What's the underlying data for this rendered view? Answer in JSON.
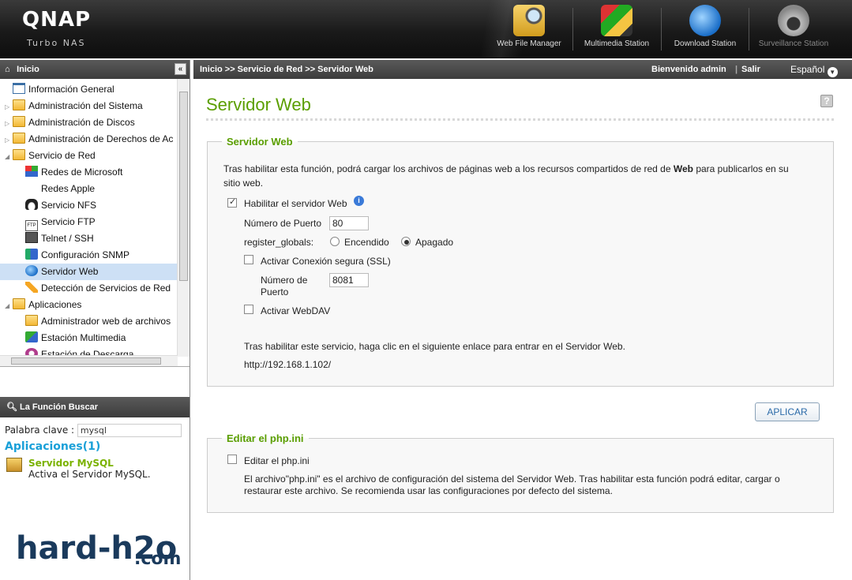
{
  "header": {
    "logo": "QNAP",
    "logo_sub": "Turbo NAS",
    "apps": [
      {
        "label": "Web File Manager",
        "icon": "folder-magnifier-icon"
      },
      {
        "label": "Multimedia Station",
        "icon": "film-clapper-icon"
      },
      {
        "label": "Download Station",
        "icon": "globe-download-icon"
      },
      {
        "label": "Surveillance Station",
        "icon": "security-camera-icon"
      }
    ]
  },
  "sidebar": {
    "title": "Inicio",
    "tree": [
      {
        "label": "Información General",
        "level": 1,
        "icon": "info-list-icon"
      },
      {
        "label": "Administración del Sistema",
        "level": 0,
        "icon": "folder-icon"
      },
      {
        "label": "Administración de Discos",
        "level": 0,
        "icon": "folder-icon"
      },
      {
        "label": "Administración de Derechos de Ac",
        "level": 0,
        "icon": "folder-icon"
      },
      {
        "label": "Servicio de Red",
        "level": 0,
        "icon": "folder-icon"
      },
      {
        "label": "Redes de Microsoft",
        "level": 1,
        "icon": "windows-logo-icon"
      },
      {
        "label": "Redes Apple",
        "level": 1,
        "icon": "apple-logo-icon"
      },
      {
        "label": "Servicio NFS",
        "level": 1,
        "icon": "penguin-icon"
      },
      {
        "label": "Servicio FTP",
        "level": 1,
        "icon": "ftp-icon"
      },
      {
        "label": "Telnet / SSH",
        "level": 1,
        "icon": "terminal-icon"
      },
      {
        "label": "Configuración SNMP",
        "level": 1,
        "icon": "network-icon"
      },
      {
        "label": "Servidor Web",
        "level": 1,
        "icon": "globe-icon",
        "selected": true
      },
      {
        "label": "Detección de Servicios de Red",
        "level": 1,
        "icon": "discovery-icon"
      },
      {
        "label": "Aplicaciones",
        "level": 0,
        "icon": "folder-icon"
      },
      {
        "label": "Administrador web de archivos",
        "level": 1,
        "icon": "folder-icon"
      },
      {
        "label": "Estación Multimedia",
        "level": 1,
        "icon": "multimedia-icon"
      },
      {
        "label": "Estación de Descarga",
        "level": 1,
        "icon": "download-icon"
      }
    ],
    "search": {
      "title": "La Función Buscar",
      "keyword_label": "Palabra clave :",
      "keyword_value": "mysql",
      "results_header": "Aplicaciones(1)",
      "result_title": "Servidor MySQL",
      "result_desc": "Activa el Servidor MySQL."
    },
    "watermark": "hard-h2o",
    "watermark_sub": ".com"
  },
  "breadcrumb": {
    "path": "Inicio >> Servicio de Red >> Servidor Web",
    "welcome": "Bienvenido admin",
    "logout": "Salir",
    "language": "Español"
  },
  "main": {
    "title": "Servidor Web",
    "web_section": {
      "legend": "Servidor Web",
      "desc_part1": "Tras habilitar esta función, podrá cargar los archivos de páginas web a los recursos compartidos de red de ",
      "desc_bold": "Web",
      "desc_part2": " para publicarlos en su",
      "desc_line2": "sitio web.",
      "enable_label": "Habilitar el servidor Web",
      "port_label": "Número de Puerto",
      "port_value": "80",
      "register_globals_label": "register_globals:",
      "on_label": "Encendido",
      "off_label": "Apagado",
      "ssl_label": "Activar Conexión segura (SSL)",
      "ssl_port_label_1": "Número de",
      "ssl_port_label_2": "Puerto",
      "ssl_port_value": "8081",
      "webdav_label": "Activar WebDAV",
      "link_info": "Tras habilitar este servicio, haga clic en el siguiente enlace para entrar en el Servidor Web.",
      "link_url": "http://192.168.1.102/"
    },
    "apply_button": "APLICAR",
    "php_section": {
      "legend": "Editar el php.ini",
      "checkbox_label": "Editar el php.ini",
      "desc_line1": "El archivo\"php.ini\" es el archivo de configuración del sistema del Servidor Web. Tras habilitar esta función podrá editar, cargar o",
      "desc_line2": "restaurar este archivo. Se recomienda usar las configuraciones por defecto del sistema."
    }
  },
  "colors": {
    "accent_green": "#5a9e00",
    "header_dark": "#1a1a1a",
    "link_blue": "#1aa0d8",
    "selected_row": "#cde0f5"
  }
}
